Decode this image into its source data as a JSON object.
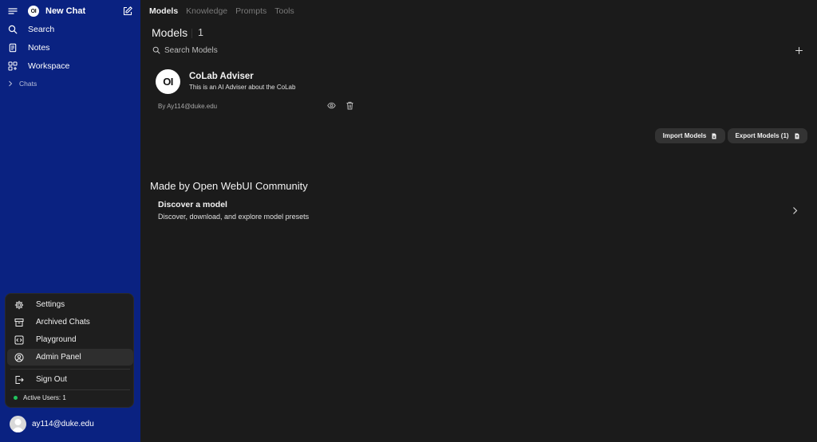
{
  "sidebar": {
    "new_chat": "New Chat",
    "logo_text": "OI",
    "items": [
      {
        "label": "Search",
        "icon": "search-icon"
      },
      {
        "label": "Notes",
        "icon": "notes-icon"
      },
      {
        "label": "Workspace",
        "icon": "workspace-icon"
      }
    ],
    "chats_label": "Chats",
    "background": "#0a2281"
  },
  "user_menu": {
    "items": [
      {
        "label": "Settings",
        "icon": "gear-icon"
      },
      {
        "label": "Archived Chats",
        "icon": "archive-icon"
      },
      {
        "label": "Playground",
        "icon": "code-icon"
      },
      {
        "label": "Admin Panel",
        "icon": "user-circle-icon",
        "active": true
      },
      {
        "label": "Sign Out",
        "icon": "sign-out-icon"
      }
    ],
    "active_users": "Active Users: 1",
    "active_users_color": "#22c55e"
  },
  "user": {
    "email": "ay114@duke.edu"
  },
  "tabs": [
    {
      "label": "Models",
      "active": true
    },
    {
      "label": "Knowledge",
      "active": false
    },
    {
      "label": "Prompts",
      "active": false
    },
    {
      "label": "Tools",
      "active": false
    }
  ],
  "models": {
    "title": "Models",
    "count": "1",
    "search_placeholder": "Search Models",
    "list": [
      {
        "logo_text": "OI",
        "name": "CoLab Adviser",
        "description": "This is an AI Adviser about the CoLab",
        "author": "By Ay114@duke.edu"
      }
    ],
    "import_label": "Import Models",
    "export_label": "Export Models (1)"
  },
  "community": {
    "title": "Made by Open WebUI Community",
    "discover_title": "Discover a model",
    "discover_subtitle": "Discover, download, and explore model presets"
  }
}
